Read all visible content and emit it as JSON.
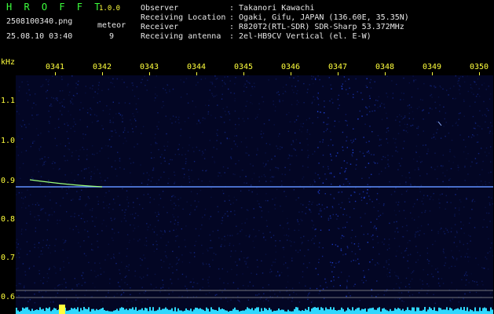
{
  "app": {
    "logo": "H R O F F T",
    "version": "1.0.0",
    "filename": "2508100340.png",
    "datetime": "25.08.10 03:40",
    "meteor_label": "meteor",
    "meteor_count": "9"
  },
  "info": [
    {
      "label": "Observer",
      "value": ": Takanori Kawachi"
    },
    {
      "label": "Receiving Location",
      "value": ": Ogaki, Gifu, JAPAN (136.60E, 35.35N)"
    },
    {
      "label": "Receiver",
      "value": ": R820T2(RTL-SDR) SDR-Sharp 53.372MHz"
    },
    {
      "label": "Receiving antenna",
      "value": ": 2el-HB9CV Vertical (el. E-W)"
    }
  ],
  "axis": {
    "y_unit": "kHz",
    "x_ticks": [
      "0341",
      "0342",
      "0343",
      "0344",
      "0345",
      "0346",
      "0347",
      "0348",
      "0349",
      "0350"
    ],
    "y_ticks": [
      "1.1",
      "1.0",
      "0.9",
      "0.8",
      "0.7",
      "0.6"
    ]
  },
  "colors": {
    "background": "#000000",
    "noise": "#0a1470",
    "carrier": "#5f8fff",
    "text": "#e8e8e8",
    "accent": "#ffff3c",
    "spectrum": "#2fd8ff"
  }
}
